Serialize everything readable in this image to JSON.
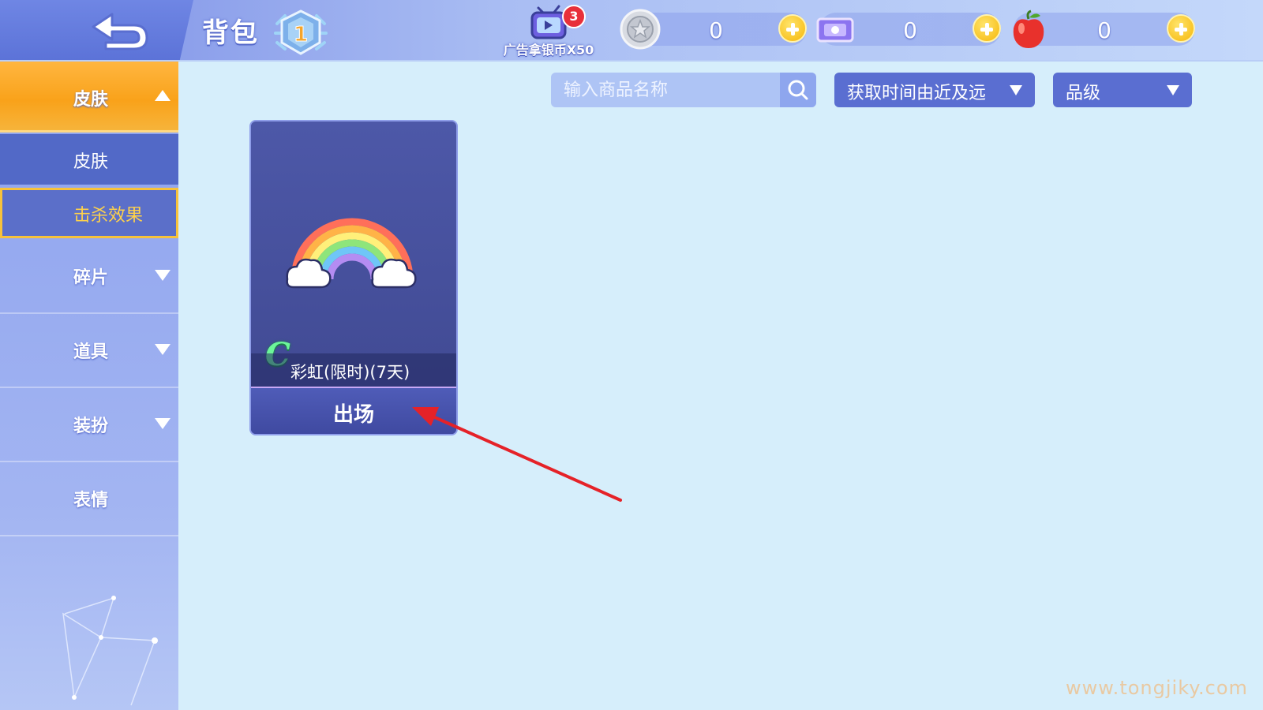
{
  "header": {
    "title": "背包",
    "level": "1",
    "ad": {
      "label": "广告拿银币X50",
      "badge_count": "3"
    },
    "currencies": [
      {
        "name": "silver-coin",
        "value": "0"
      },
      {
        "name": "ticket",
        "value": "0"
      },
      {
        "name": "apple",
        "value": "0"
      }
    ]
  },
  "sidebar": {
    "skin": {
      "label": "皮肤",
      "expanded": true
    },
    "sub_items": [
      {
        "label": "皮肤",
        "selected": false
      },
      {
        "label": "击杀效果",
        "selected": true
      }
    ],
    "fragments": {
      "label": "碎片"
    },
    "props": {
      "label": "道具"
    },
    "outfits": {
      "label": "装扮"
    },
    "emotes": {
      "label": "表情"
    }
  },
  "filters": {
    "search_placeholder": "输入商品名称",
    "sort_label": "获取时间由近及远",
    "grade_label": "品级"
  },
  "items": [
    {
      "grade": "C",
      "name": "彩虹(限时)(7天)",
      "action_label": "出场"
    }
  ],
  "watermark": "www.tongjiky.com",
  "colors": {
    "accent_orange": "#f9a21a",
    "sidebar_blue": "#8da2ee",
    "selected_text": "#ffd24a",
    "grade_c": "#6cf59a",
    "annotation_arrow": "#e52228"
  }
}
